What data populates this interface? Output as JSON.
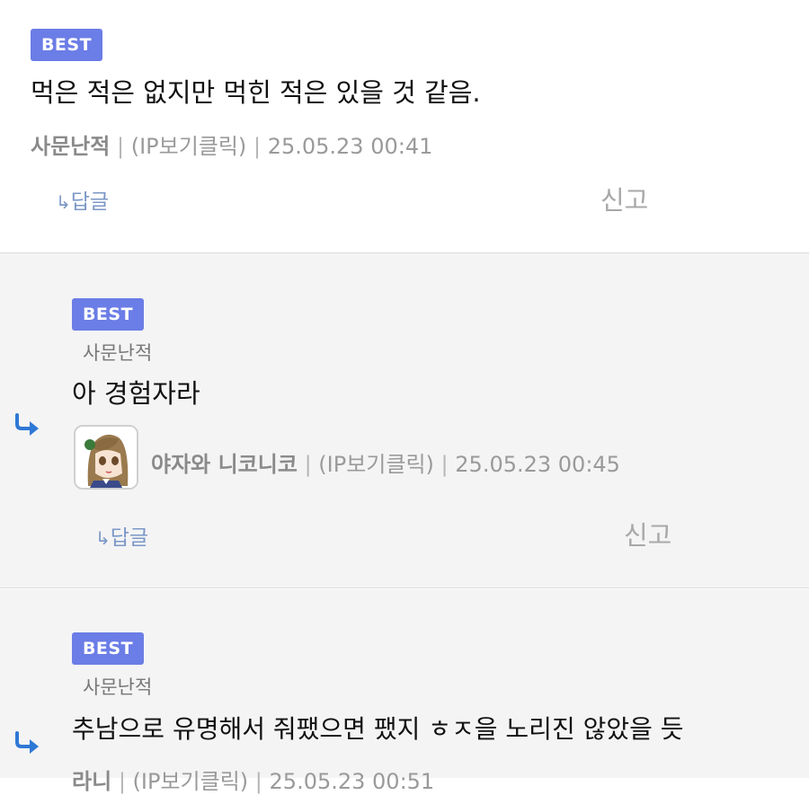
{
  "comments": [
    {
      "badge": "BEST",
      "text": "먹은 적은 없지만 먹힌 적은 있을 것 같음.",
      "nick": "사문난적",
      "ip": "(IP보기클릭)",
      "date": "25.05.23 00:41",
      "reply": "답글",
      "report": "신고"
    },
    {
      "badge": "BEST",
      "parent": "사문난적",
      "text": "아 경험자라",
      "nick": "야자와 니코니코",
      "ip": "(IP보기클릭)",
      "date": "25.05.23 00:45",
      "reply": "답글",
      "report": "신고"
    },
    {
      "badge": "BEST",
      "parent": "사문난적",
      "text": "추남으로 유명해서 줘팼으면 팼지 ㅎㅈ을 노리진 않았을 듯",
      "nick": "라니",
      "ip": "(IP보기클릭)",
      "date": "25.05.23 00:51"
    }
  ],
  "separator": "|",
  "icons": {
    "reply_arrow": "reply-arrow-icon",
    "thread": "thread-reply-icon"
  },
  "colors": {
    "badge": "#6b7de6",
    "reply_link": "#7b97c6",
    "thread_arrow": "#2e78d6"
  }
}
